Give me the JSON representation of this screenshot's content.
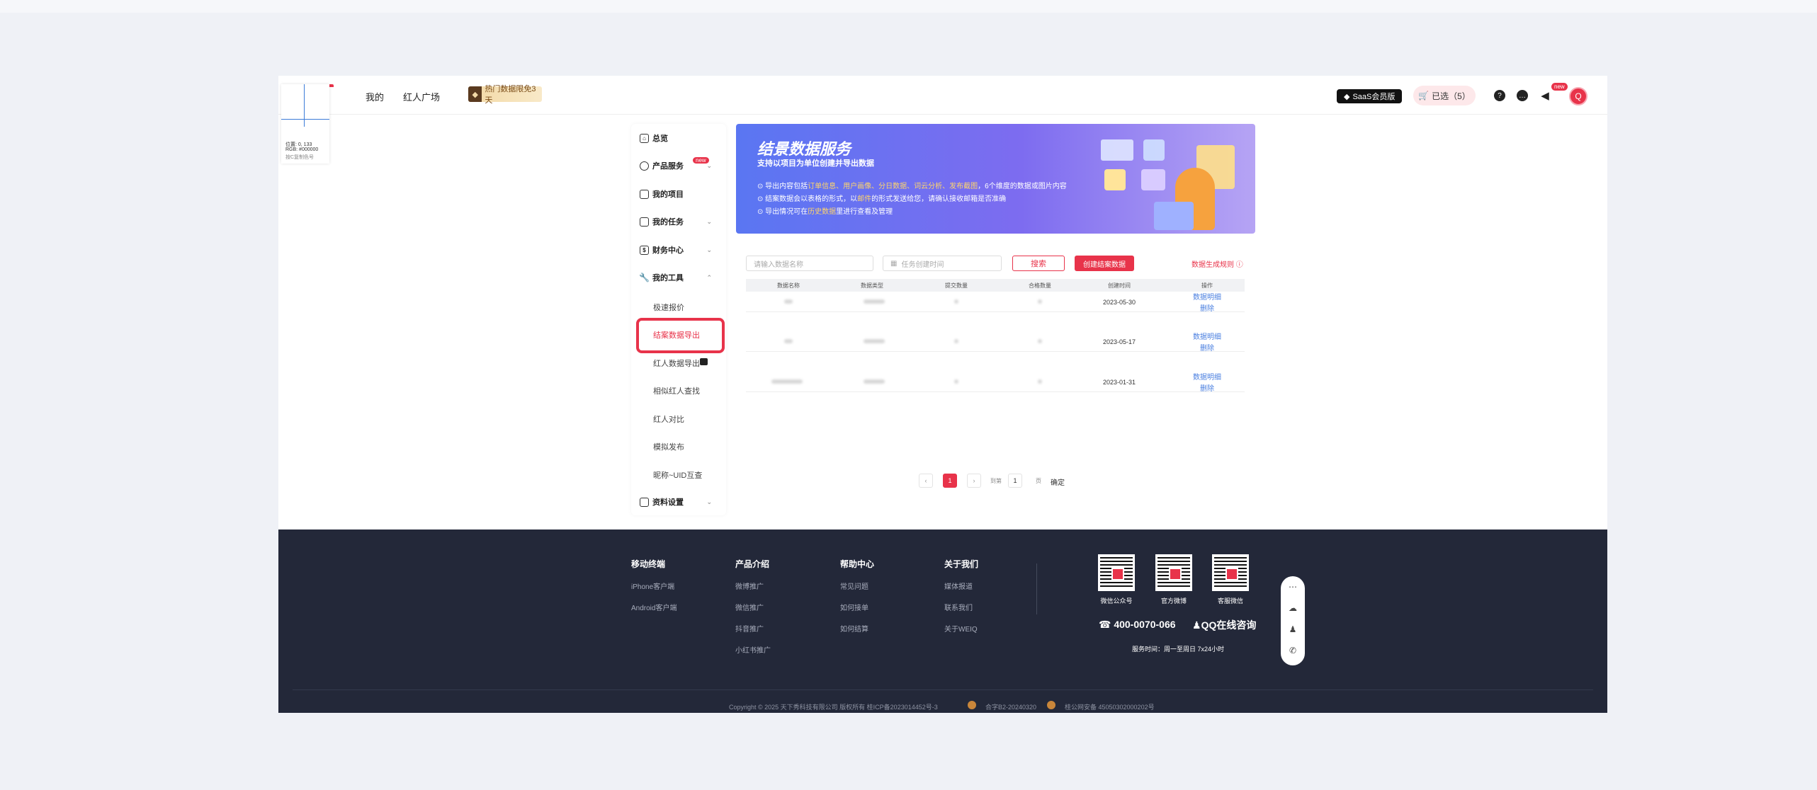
{
  "header": {
    "nav": [
      "我的",
      "红人广场"
    ],
    "promo": "热门数据限免3天",
    "saas": "SaaS会员版",
    "cart": "已选（5）",
    "new_badge": "new"
  },
  "picker": {
    "position": "位置: 0, 133",
    "rgb": "RGB: #000000",
    "hint": "按C复制色号"
  },
  "sidebar": {
    "overview": "总览",
    "product": "产品服务",
    "product_badge": "new",
    "projects": "我的项目",
    "tasks": "我的任务",
    "finance": "财务中心",
    "tools": "我的工具",
    "sub": [
      "极速报价",
      "结案数据导出",
      "红人数据导出",
      "相似红人查找",
      "红人对比",
      "模拟发布",
      "昵称~UID互查"
    ],
    "settings": "资料设置"
  },
  "banner": {
    "title": "结景数据服务",
    "subtitle": "支持以项目为单位创建并导出数据",
    "line1_pre": "导出内容包括",
    "line1_hl": "订单信息、用户画像、分日数据、词云分析、发布截图",
    "line1_post": "，6个维度的数据或图片内容",
    "line2_pre": "结案数据会以表格的形式，以",
    "line2_hl": "邮件",
    "line2_post": "的形式发送给您，请确认接收邮箱是否准确",
    "line3_pre": "导出情况可在",
    "line3_hl": "历史数据",
    "line3_post": "里进行查看及管理"
  },
  "toolbar": {
    "name_placeholder": "请输入数据名称",
    "time_placeholder": "任务创建时间",
    "search": "搜索",
    "create": "创建结案数据",
    "rules": "数据生成规则 ⓘ"
  },
  "table": {
    "headers": [
      "数据名称",
      "数据类型",
      "提交数量",
      "合格数量",
      "创建时间",
      "操作"
    ],
    "rows": [
      {
        "date": "2023-05-30",
        "detail": "数据明细",
        "delete": "删除"
      },
      {
        "date": "2023-05-17",
        "detail": "数据明细",
        "delete": "删除"
      },
      {
        "date": "2023-01-31",
        "detail": "数据明细",
        "delete": "删除"
      }
    ]
  },
  "pagination": {
    "prev": "‹",
    "current": "1",
    "next": "›",
    "goto": "到第",
    "page_value": "1",
    "page_unit": "页",
    "confirm": "确定"
  },
  "footer": {
    "cols": [
      {
        "title": "移动终端",
        "links": [
          "iPhone客户端",
          "Android客户端"
        ]
      },
      {
        "title": "产品介绍",
        "links": [
          "微博推广",
          "微信推广",
          "抖音推广",
          "小红书推广"
        ]
      },
      {
        "title": "帮助中心",
        "links": [
          "常见问题",
          "如何接单",
          "如何结算"
        ]
      },
      {
        "title": "关于我们",
        "links": [
          "媒体报道",
          "联系我们",
          "关于WEIQ"
        ]
      }
    ],
    "qr_labels": [
      "微信公众号",
      "官方微博",
      "客服微信"
    ],
    "phone": "☎ 400-0070-066",
    "qq": "QQ在线咨询",
    "service": "服务时间：周一至周日 7x24小时",
    "copyright": "Copyright © 2025 天下秀科技有限公司 版权所有 桂ICP备2023014452号-3",
    "license1": "合字B2-20240320",
    "license2": "桂公网安备 45050302000202号"
  },
  "colors": {
    "accent": "#e8334a",
    "footer_bg": "#232839",
    "link": "#4a7fe0"
  }
}
